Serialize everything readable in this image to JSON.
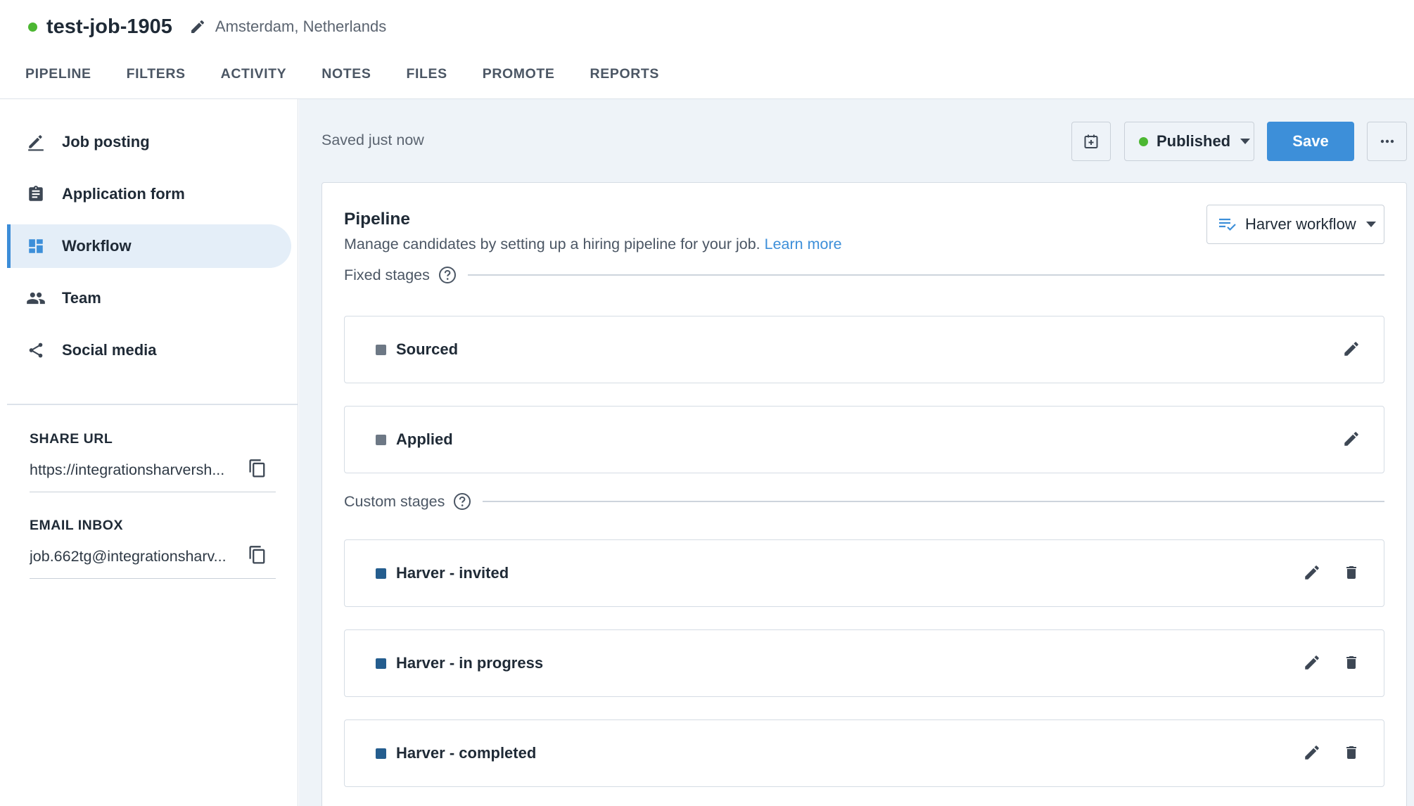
{
  "header": {
    "job_title": "test-job-1905",
    "status_color": "#4cb732",
    "location": "Amsterdam, Netherlands",
    "tabs": [
      "PIPELINE",
      "FILTERS",
      "ACTIVITY",
      "NOTES",
      "FILES",
      "PROMOTE",
      "REPORTS"
    ]
  },
  "sidebar": {
    "items": [
      {
        "label": "Job posting",
        "icon": "pencil-icon"
      },
      {
        "label": "Application form",
        "icon": "clipboard-icon"
      },
      {
        "label": "Workflow",
        "icon": "dashboard-icon",
        "active": true
      },
      {
        "label": "Team",
        "icon": "people-icon"
      },
      {
        "label": "Social media",
        "icon": "share-icon"
      }
    ],
    "share_url": {
      "label": "SHARE URL",
      "value": "https://integrationsharversh..."
    },
    "email_inbox": {
      "label": "EMAIL INBOX",
      "value": "job.662tg@integrationsharv..."
    }
  },
  "toolbar": {
    "saved_text": "Saved just now",
    "status_label": "Published",
    "save_label": "Save",
    "more_label": "···"
  },
  "pipeline": {
    "title": "Pipeline",
    "description": "Manage candidates by setting up a hiring pipeline for your job.",
    "learn_more": "Learn more",
    "workflow_select": "Harver workflow",
    "fixed_label": "Fixed stages",
    "custom_label": "Custom stages",
    "fixed_stages": [
      "Sourced",
      "Applied"
    ],
    "custom_stages": [
      "Harver - invited",
      "Harver - in progress",
      "Harver - completed"
    ],
    "colors": {
      "fixed": "#6d7885",
      "custom": "#245d8e",
      "accent": "#3d8fd9"
    }
  }
}
